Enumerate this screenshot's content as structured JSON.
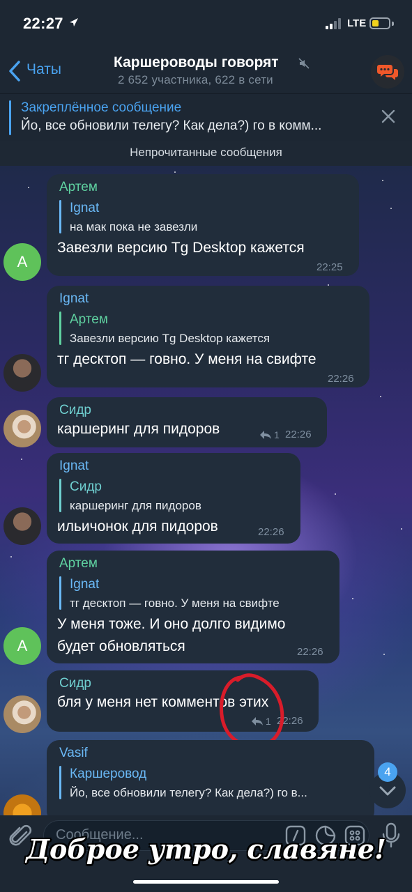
{
  "status_bar": {
    "time": "22:27",
    "network": "LTE"
  },
  "header": {
    "back_label": "Чаты",
    "title": "Каршероводы говорят",
    "subtitle": "2 652 участника, 622 в сети"
  },
  "pinned": {
    "title": "Закреплённое сообщение",
    "text": "Йо, все обновили телегу? Как дела?) го в комм..."
  },
  "unread_label": "Непрочитанные сообщения",
  "messages": [
    {
      "sender": "Артем",
      "avatar_letter": "А",
      "reply_name": "Ignat",
      "reply_text": "на мак пока не завезли",
      "text": "Завезли версию Tg Desktop кажется",
      "time": "22:25"
    },
    {
      "sender": "Ignat",
      "reply_name": "Артем",
      "reply_text": "Завезли версию Tg Desktop кажется",
      "text": "тг десктоп — говно. У меня на свифте",
      "time": "22:26"
    },
    {
      "sender": "Сидр",
      "text": "каршеринг для пидоров",
      "replies": "1",
      "time": "22:26"
    },
    {
      "sender": "Ignat",
      "reply_name": "Сидр",
      "reply_text": "каршеринг для пидоров",
      "text": "ильичонок для пидоров",
      "time": "22:26"
    },
    {
      "sender": "Артем",
      "avatar_letter": "А",
      "reply_name": "Ignat",
      "reply_text": "тг десктоп — говно. У меня на свифте",
      "text_line1": "У меня тоже. И оно долго видимо",
      "text_line2": "будет обновляться",
      "time": "22:26"
    },
    {
      "sender": "Сидр",
      "text": "бля у меня нет комментов этих",
      "replies": "1",
      "time": "22:26"
    },
    {
      "sender": "Vasif",
      "reply_name": "Каршеровод",
      "reply_text": "Йо, все обновили телегу? Как дела?) го в..."
    }
  ],
  "scroll_badge": "4",
  "composer": {
    "placeholder": "Сообщение..."
  },
  "caption": "Доброе утро, славяне!",
  "colors": {
    "accent": "#4aa3f0",
    "bubble": "#212d3b",
    "name_green": "#5fd1a0",
    "name_blue": "#6ab8f5",
    "name_teal": "#6fcfd0",
    "annotation_red": "#d91c2a"
  }
}
